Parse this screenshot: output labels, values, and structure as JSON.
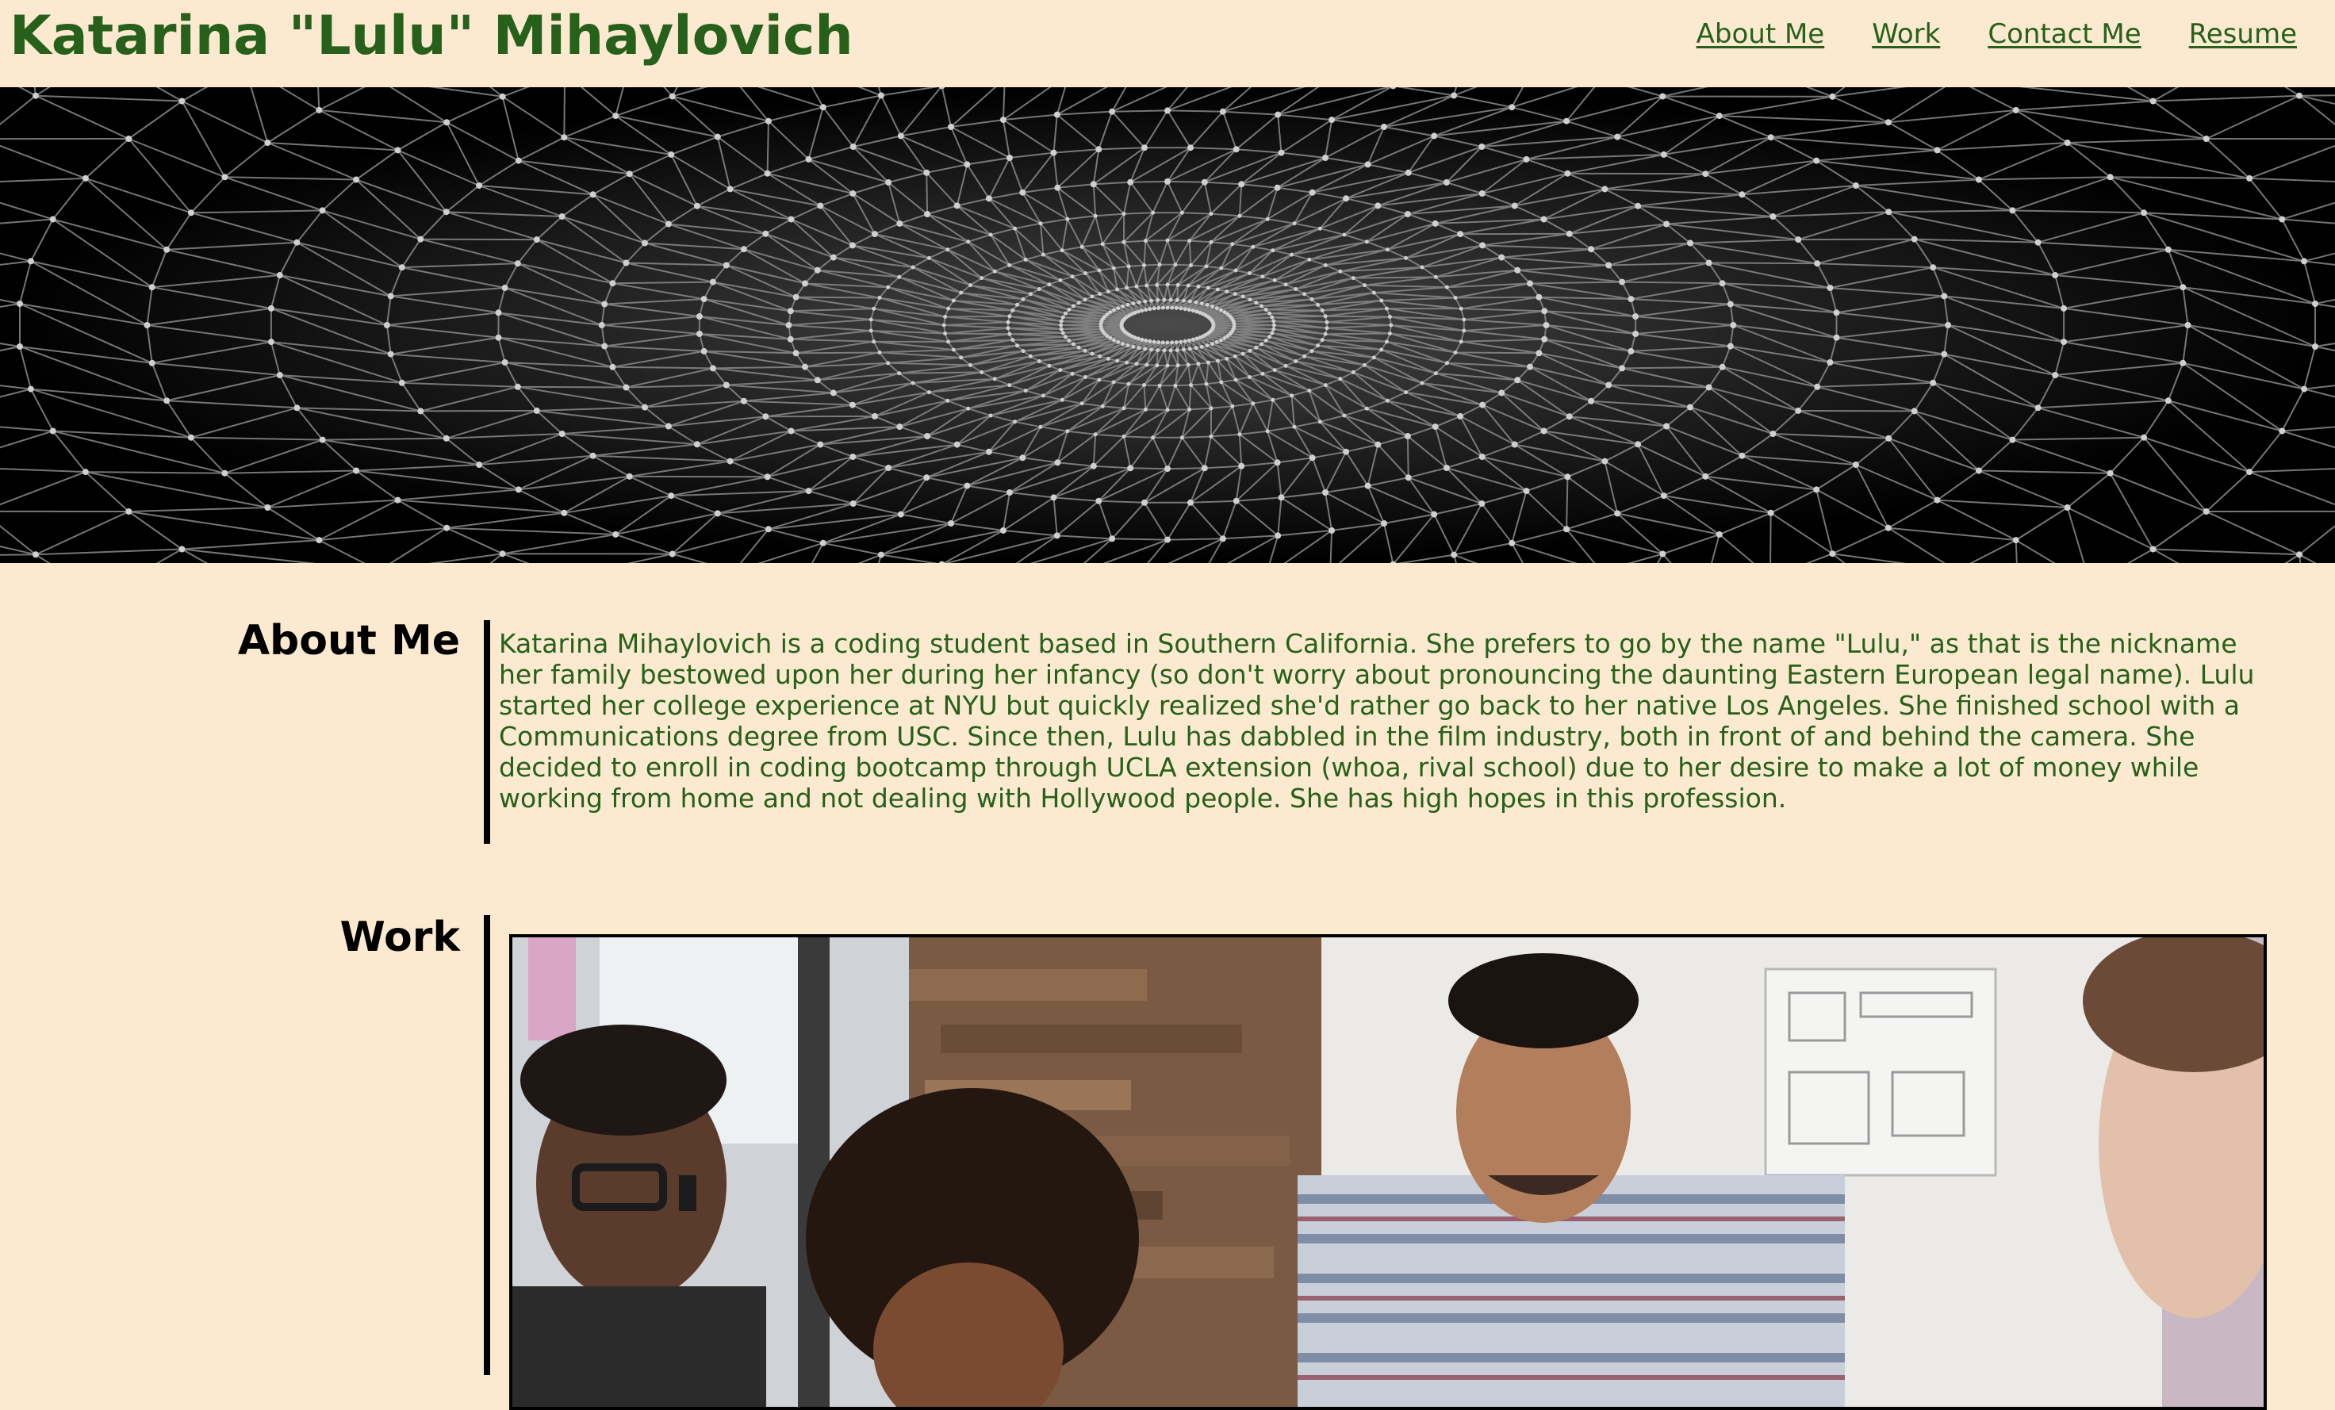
{
  "header": {
    "title": "Katarina \"Lulu\" Mihaylovich",
    "nav": [
      {
        "label": "About Me"
      },
      {
        "label": "Work"
      },
      {
        "label": "Contact Me"
      },
      {
        "label": "Resume"
      }
    ]
  },
  "hero": {
    "image": "abstract-geometric-mesh-banner"
  },
  "about": {
    "heading": "About Me",
    "text": "Katarina Mihaylovich is a coding student based in Southern California. She prefers to go by the name \"Lulu,\" as that is the nickname her family bestowed upon her during her infancy (so don't worry about pronouncing the daunting Eastern European legal name). Lulu started her college experience at NYU but quickly realized she'd rather go back to her native Los Angeles. She finished school with a Communications degree from USC. Since then, Lulu has dabbled in the film industry, both in front of and behind the camera. She decided to enroll in coding bootcamp through UCLA extension (whoa, rival school) due to her desire to make a lot of money while working from home and not dealing with Hollywood people. She has high hopes in this profession."
  },
  "work": {
    "heading": "Work",
    "image": "team-collaboration-photo"
  },
  "colors": {
    "background": "#fbe9d0",
    "accent_green": "#27601a",
    "heading_black": "#000000"
  }
}
